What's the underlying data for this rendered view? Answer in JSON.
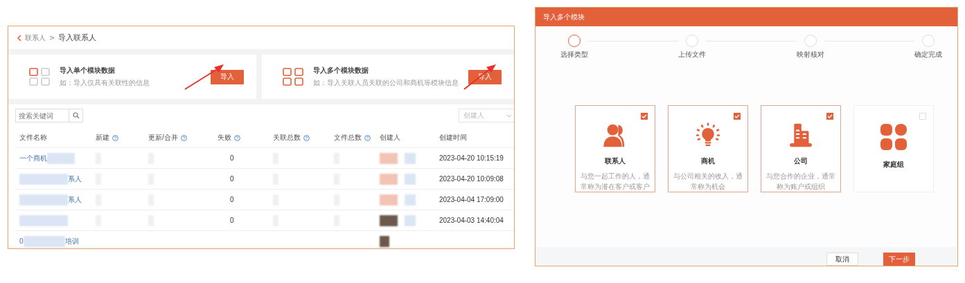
{
  "breadcrumb": {
    "parent": "联系人",
    "separator": ">",
    "current": "导入联系人"
  },
  "import_options": [
    {
      "kind": "single",
      "title": "导入单个模块数据",
      "description": "如：导入仅具有关联性的信息",
      "button": "导入"
    },
    {
      "kind": "multiple",
      "title": "导入多个模块数据",
      "description": "如：导入关联人员关联的公司和商机等模块信息",
      "button": "导入"
    }
  ],
  "search": {
    "placeholder": "搜索关键词"
  },
  "creator_filter": {
    "placeholder": "创建人"
  },
  "table": {
    "columns": [
      {
        "label": "文件名称",
        "help": false
      },
      {
        "label": "新建",
        "help": true
      },
      {
        "label": "更新/合并",
        "help": true
      },
      {
        "label": "失败",
        "help": true
      },
      {
        "label": "关联总数",
        "help": true
      },
      {
        "label": "文件总数",
        "help": true
      },
      {
        "label": "创建人",
        "help": false
      },
      {
        "label": "创建时间",
        "help": false
      }
    ],
    "rows": [
      {
        "file_name_start": "一个商机",
        "file_name_end": "",
        "failed": "0",
        "created_at": "2023-04-20 10:15:19"
      },
      {
        "file_name_start": "",
        "file_name_end": "系人",
        "failed": "0",
        "created_at": "2023-04-20 10:09:08"
      },
      {
        "file_name_start": "",
        "file_name_end": "系人",
        "failed": "0",
        "created_at": "2023-04-04 17:09:00"
      },
      {
        "file_name_start": "",
        "file_name_end": "",
        "failed": "0",
        "created_at": "2023-04-03 14:40:04"
      },
      {
        "file_name_start": "0",
        "file_name_end": "培训",
        "failed": "",
        "created_at": ""
      }
    ]
  },
  "dialog": {
    "title": "导入多个模块",
    "steps": [
      {
        "label": "选择类型",
        "selected": true
      },
      {
        "label": "上传文件",
        "selected": false
      },
      {
        "label": "映射核对",
        "selected": false
      },
      {
        "label": "确定完成",
        "selected": false
      }
    ],
    "modules": [
      {
        "kind": "contact",
        "name": "联系人",
        "description": "与您一起工作的人，通常称为潜在客户或客户",
        "checked": true
      },
      {
        "kind": "opportunity",
        "name": "商机",
        "description": "与公司相关的收入，通常称为机会",
        "checked": true
      },
      {
        "kind": "company",
        "name": "公司",
        "description": "与您合作的企业，通常称为账户或组织",
        "checked": true
      },
      {
        "kind": "family",
        "name": "家庭组",
        "checked": false
      }
    ],
    "buttons": [
      {
        "kind": "secondary",
        "label": "取消"
      },
      {
        "kind": "primary",
        "label": "下一步"
      }
    ]
  }
}
